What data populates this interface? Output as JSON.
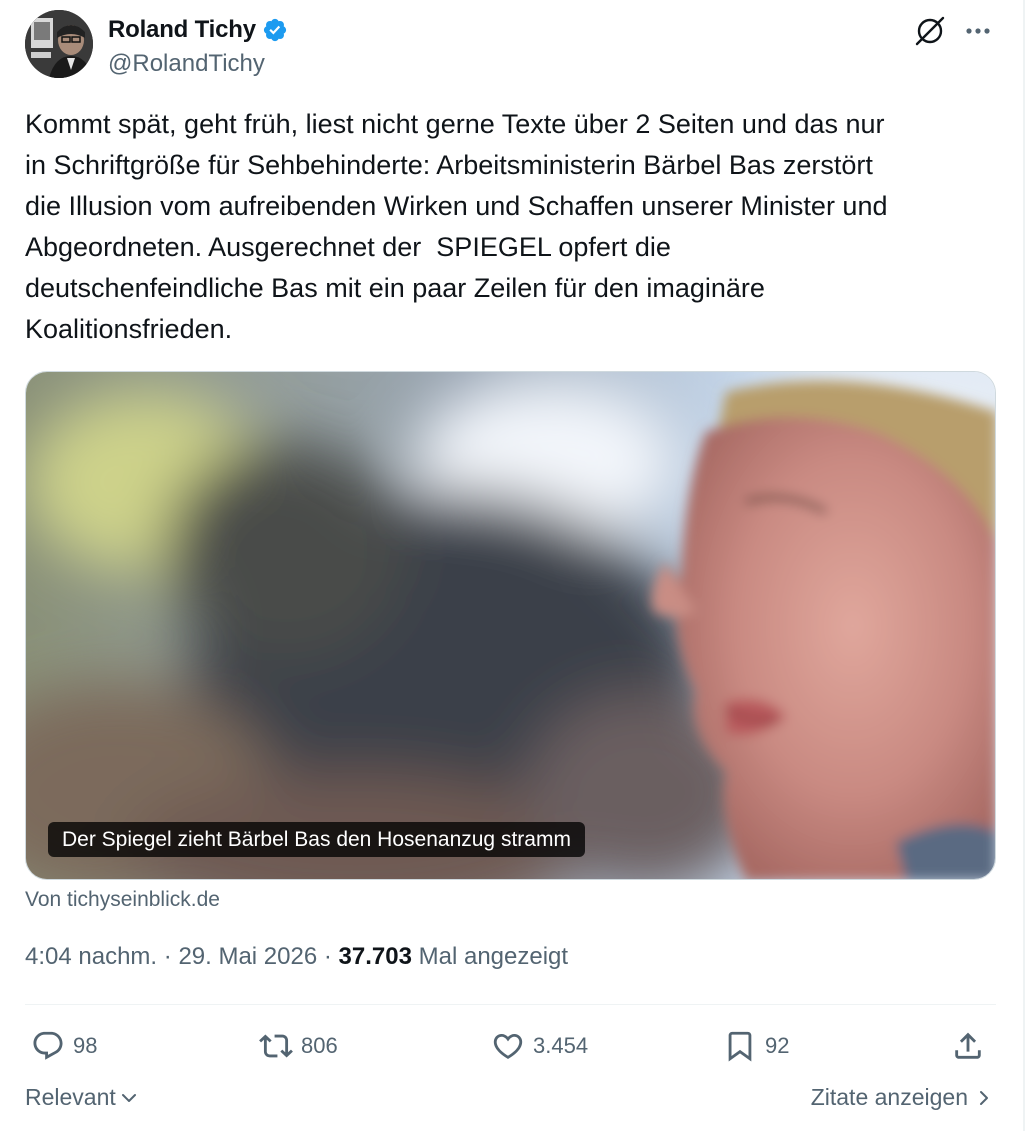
{
  "author": {
    "display_name": "Roland Tichy",
    "handle": "@RolandTichy",
    "verified_color": "#1d9bf0"
  },
  "tweet": {
    "text": "Kommt spät, geht früh, liest nicht gerne Texte über 2 Seiten und das nur\nin Schriftgröße für Sehbehinderte: Arbeitsministerin Bärbel Bas zerstört\ndie Illusion vom aufreibenden Wirken und Schaffen unserer Minister und\nAbgeordneten. Ausgerechnet der  SPIEGEL opfert die\ndeutschenfeindliche Bas mit ein paar Zeilen für den imaginäre\nKoalitionsfrieden."
  },
  "card": {
    "caption": "Der Spiegel zieht Bärbel Bas den Hosenanzug stramm",
    "source": "Von tichyseinblick.de"
  },
  "meta": {
    "time": "4:04 nachm.",
    "separator": "·",
    "date": "29. Mai 2026",
    "views": "37.703",
    "views_label": "Mal angezeigt"
  },
  "actions": {
    "replies": "98",
    "reposts": "806",
    "likes": "3.454",
    "bookmarks": "92"
  },
  "footer": {
    "sort_label": "Relevant",
    "quotes_label": "Zitate anzeigen"
  },
  "icons": {
    "header": [
      "grok-icon",
      "more-icon"
    ],
    "actions": [
      "reply-icon",
      "repost-icon",
      "like-icon",
      "bookmark-icon",
      "share-icon"
    ]
  },
  "colors": {
    "text": "#0f1419",
    "secondary": "#536471",
    "verified": "#1d9bf0",
    "border": "#cfd9de"
  }
}
